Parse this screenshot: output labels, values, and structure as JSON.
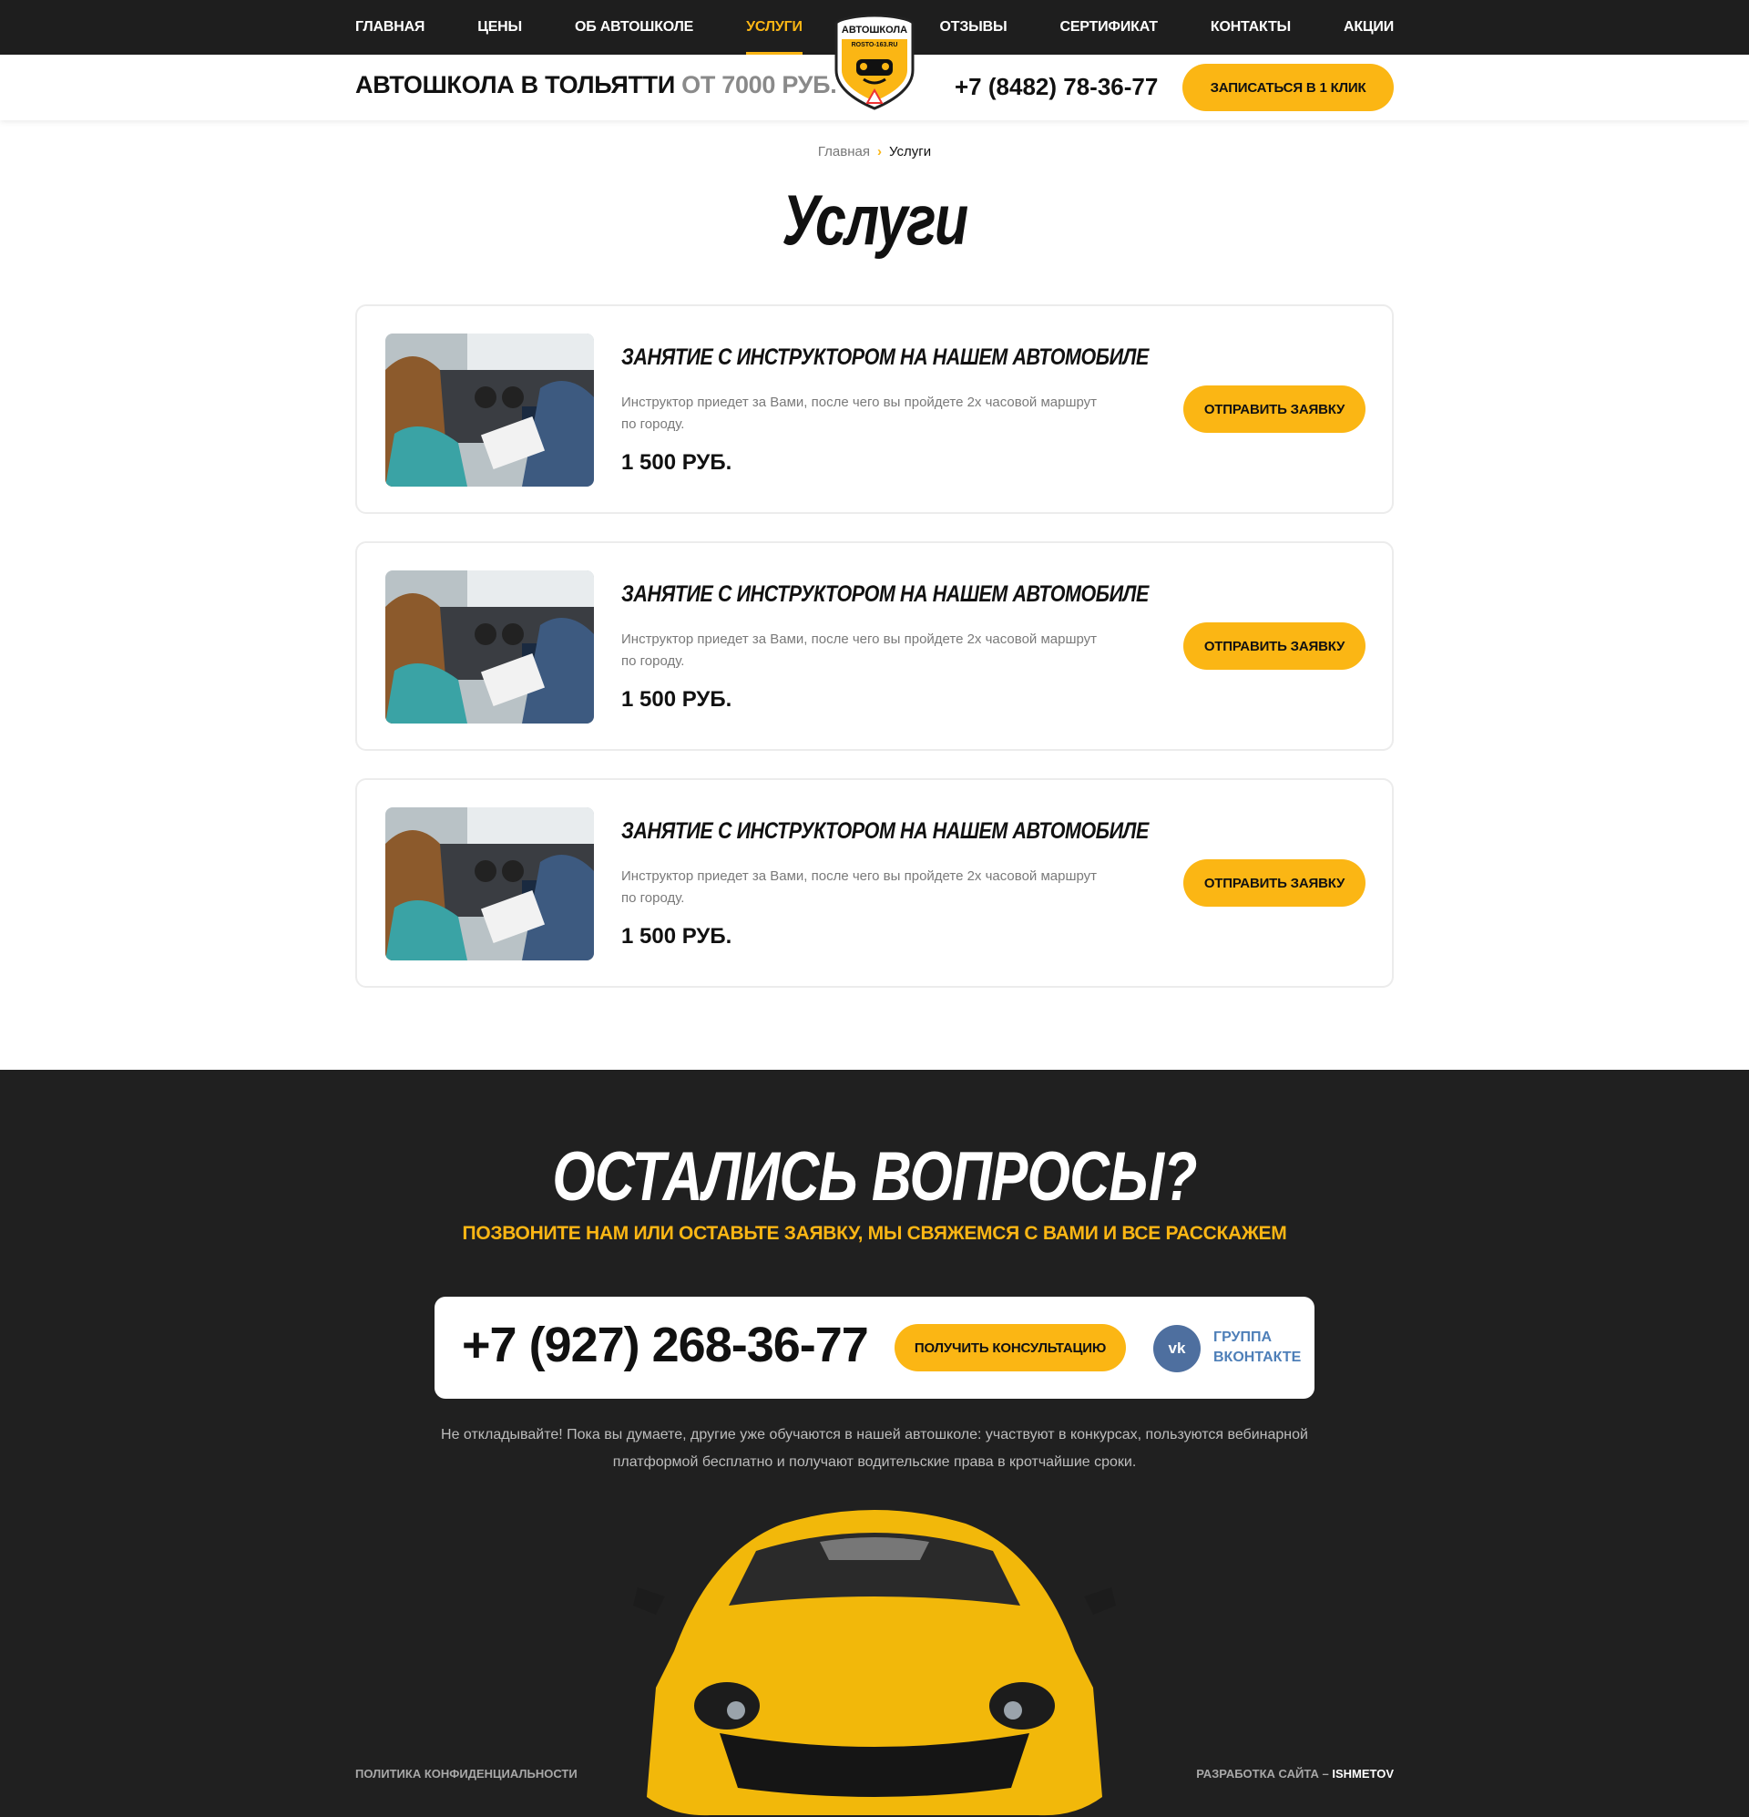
{
  "nav": {
    "left": [
      "Главная",
      "Цены",
      "Об автошколе",
      "Услуги"
    ],
    "right": [
      "Отзывы",
      "Сертификат",
      "Контакты",
      "Акции"
    ],
    "active_label": "Услуги"
  },
  "logo": {
    "line1": "АВТОШКОЛА",
    "line2": "ROSTO-163.RU"
  },
  "header": {
    "title_main": "Автошкола в Тольятти",
    "title_price": "от 7000 руб.",
    "phone": "+7 (8482) 78-36-77",
    "cta_label": "Записаться в 1 клик"
  },
  "breadcrumb": {
    "home": "Главная",
    "separator": "›",
    "current": "Услуги"
  },
  "page": {
    "title": "Услуги"
  },
  "services": [
    {
      "title": "Занятие с инструктором на нашем автомобиле",
      "description": "Инструктор приедет за Вами, после чего вы пройдете 2х часовой маршрут по городу.",
      "price": "1 500 руб.",
      "button": "Отправить заявку"
    },
    {
      "title": "Занятие с инструктором на нашем автомобиле",
      "description": "Инструктор приедет за Вами, после чего вы пройдете 2х часовой маршрут по городу.",
      "price": "1 500 руб.",
      "button": "Отправить заявку"
    },
    {
      "title": "Занятие с инструктором на нашем автомобиле",
      "description": "Инструктор приедет за Вами, после чего вы пройдете 2х часовой маршрут по городу.",
      "price": "1 500 руб.",
      "button": "Отправить заявку"
    }
  ],
  "contact": {
    "title": "Остались вопросы?",
    "subtitle": "Позвоните нам или оставьте заявку, мы свяжемся с вами и все расскажем",
    "phone": "+7 (927) 268-36-77",
    "button": "Получить консультацию",
    "vk_icon_text": "vk",
    "vk_label": "Группа Вконтакте",
    "text": "Не откладывайте! Пока вы думаете, другие уже обучаются в нашей автошколе: участвуют в конкурсах, пользуются вебинарной платформой бесплатно и получают водительские права в кротчайшие сроки."
  },
  "footer": {
    "privacy": "Политика конфиденциальности",
    "dev_label": "Разработка сайта –",
    "dev_brand": "ISHMETOV"
  },
  "colors": {
    "accent": "#fbb614",
    "dark_bg": "#202020",
    "topbar_bg": "#1e1e1e",
    "vk": "#4e6f9f"
  },
  "icons": [
    "logo-emblem",
    "chevron-right-icon",
    "vk-icon"
  ]
}
